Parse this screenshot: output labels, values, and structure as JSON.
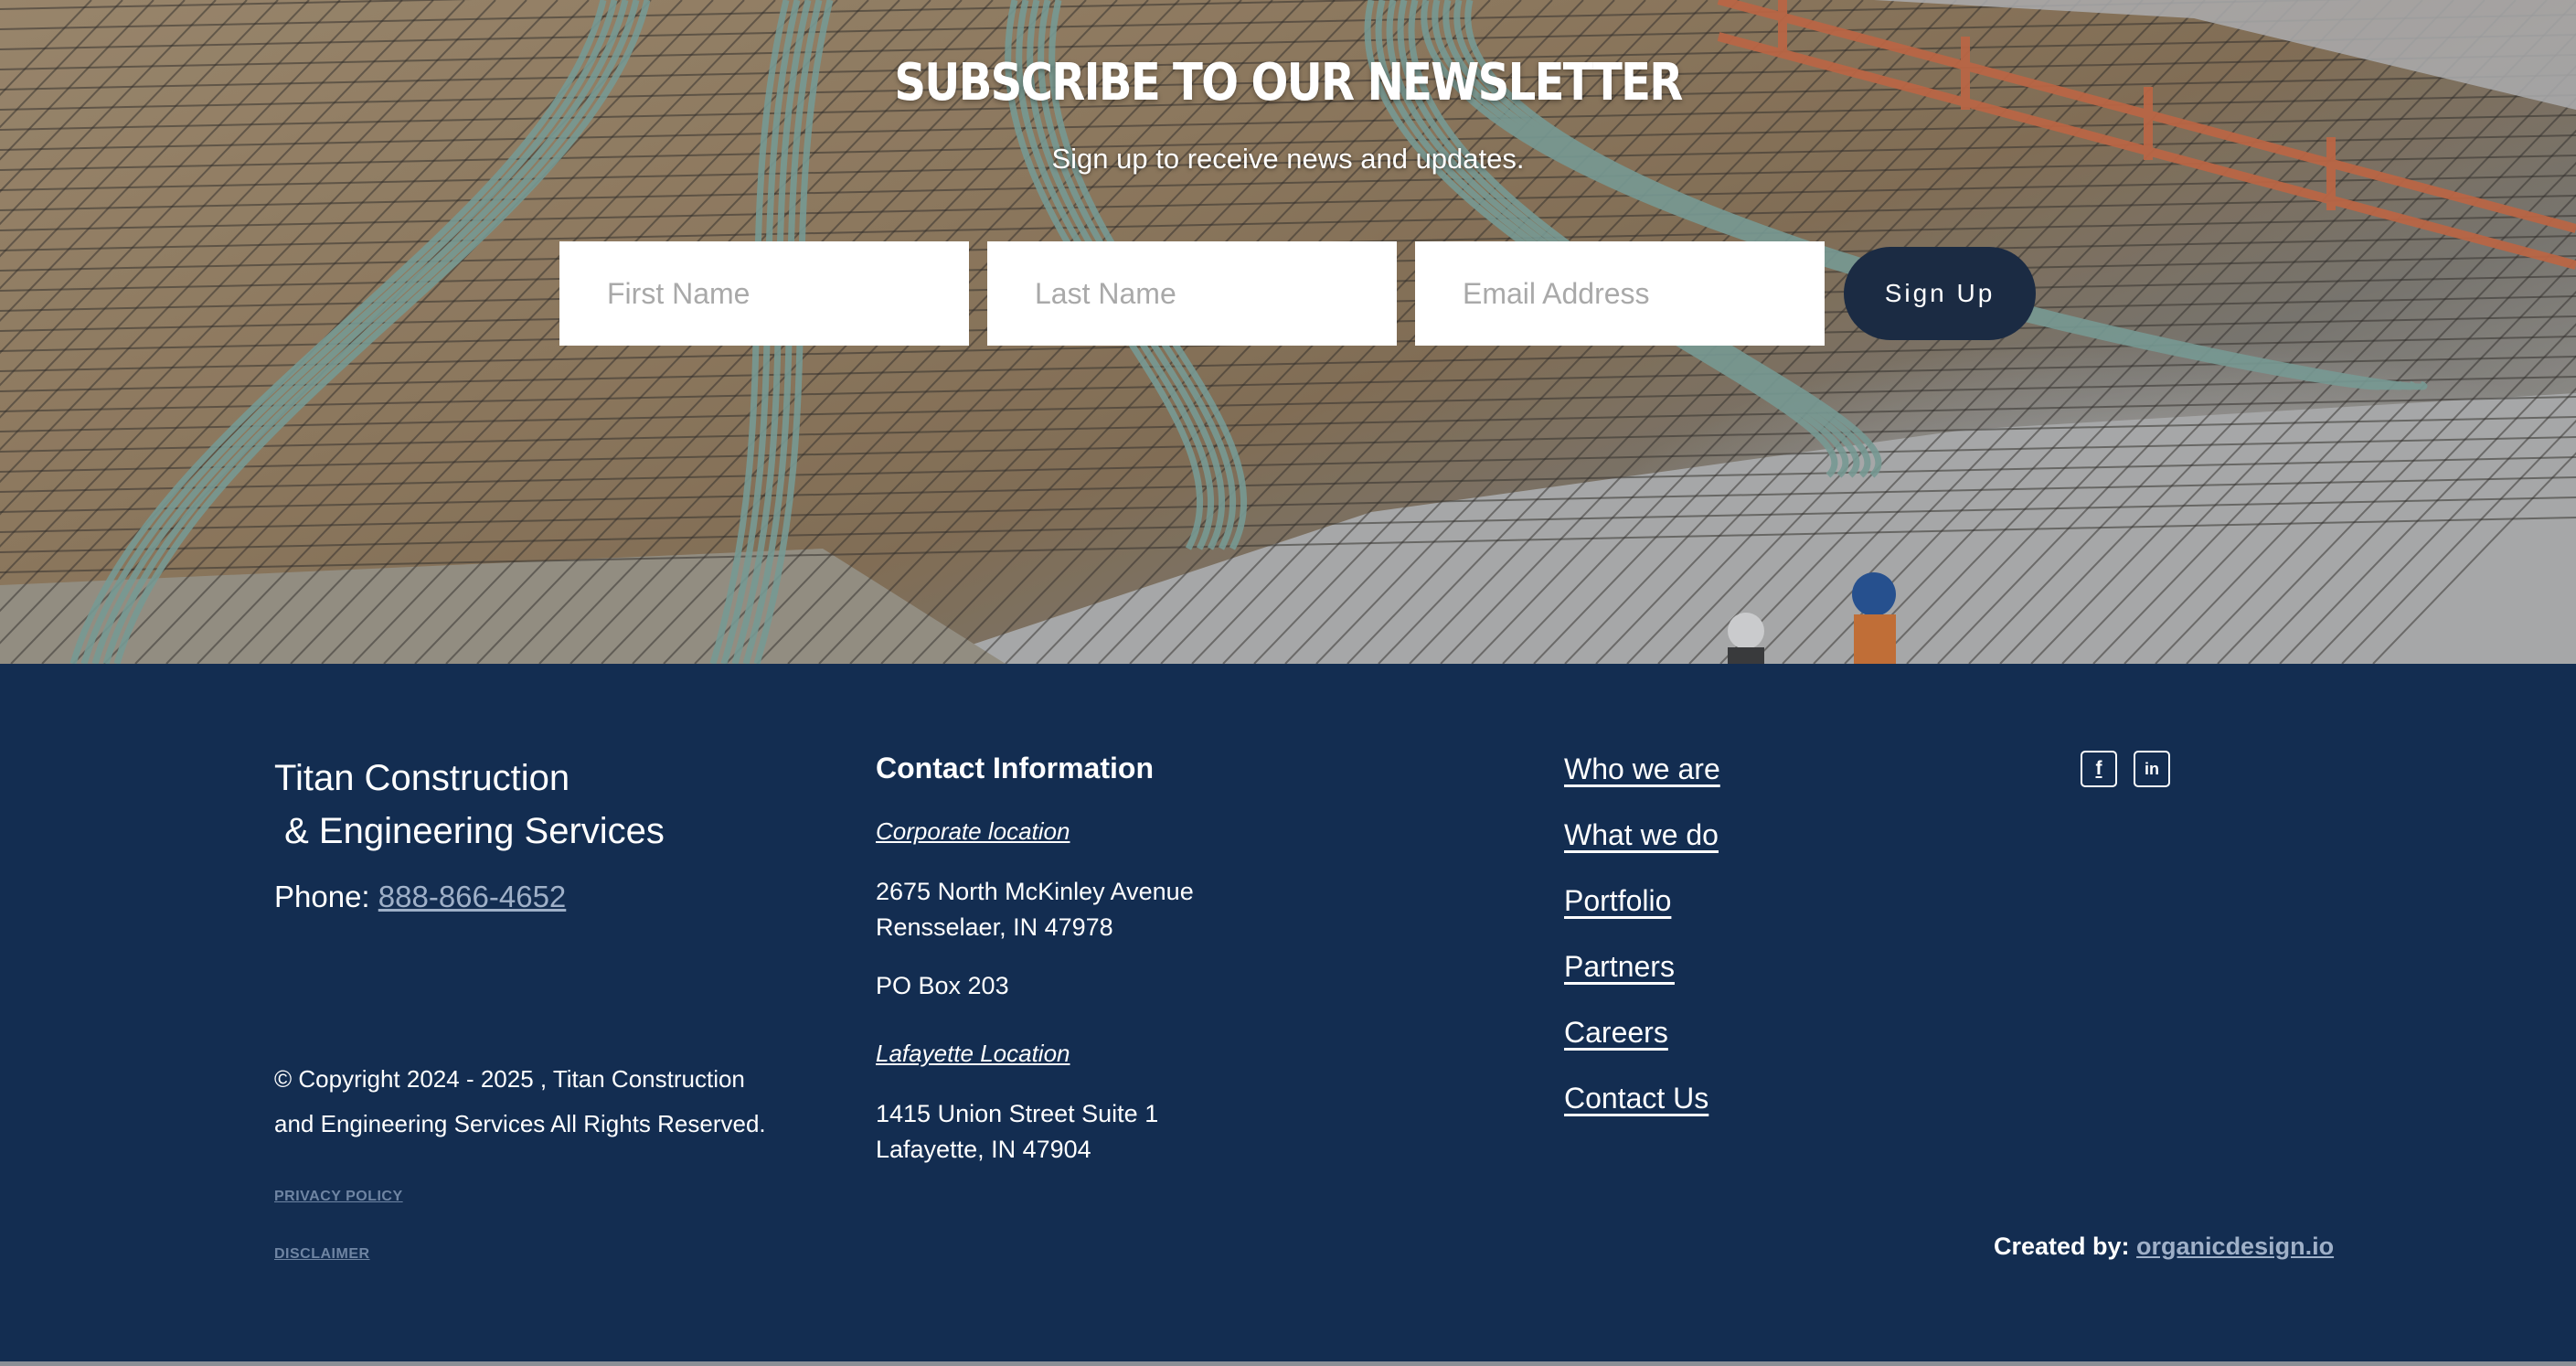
{
  "newsletter": {
    "title": "SUBSCRIBE TO OUR NEWSLETTER",
    "subtitle": "Sign up to receive news and updates.",
    "first_name_placeholder": "First Name",
    "last_name_placeholder": "Last Name",
    "email_placeholder": "Email Address",
    "signup_label": "Sign Up"
  },
  "footer": {
    "company_line1": "Titan Construction",
    "company_line2": " & Engineering Services",
    "phone_label": "Phone: ",
    "phone_number": "888-866-4652",
    "copyright": "© Copyright 2024 - 2025 , Titan Construction and Engineering Services All Rights Reserved.",
    "privacy_policy": "PRIVACY POLICY",
    "disclaimer": "DISCLAIMER",
    "contact": {
      "title": "Contact Information",
      "corporate_label": "Corporate location",
      "corporate_line1": "2675 North McKinley Avenue",
      "corporate_line2": "Rensselaer, IN 47978",
      "po_box": "PO Box 203",
      "lafayette_label": "Lafayette Location",
      "lafayette_line1": "1415 Union Street Suite 1",
      "lafayette_line2": "Lafayette, IN 47904"
    },
    "nav": [
      {
        "label": "Who we are"
      },
      {
        "label": "What we do"
      },
      {
        "label": "Portfolio"
      },
      {
        "label": "Partners"
      },
      {
        "label": "Careers"
      },
      {
        "label": "Contact Us"
      }
    ],
    "social": {
      "facebook_glyph": "f",
      "linkedin_glyph": "in"
    },
    "created_label": "Created by: ",
    "created_link": "organicdesign.io"
  },
  "colors": {
    "footer_bg": "#132d51",
    "button_bg": "#1b2b43",
    "link_muted": "#9fb0c8"
  }
}
